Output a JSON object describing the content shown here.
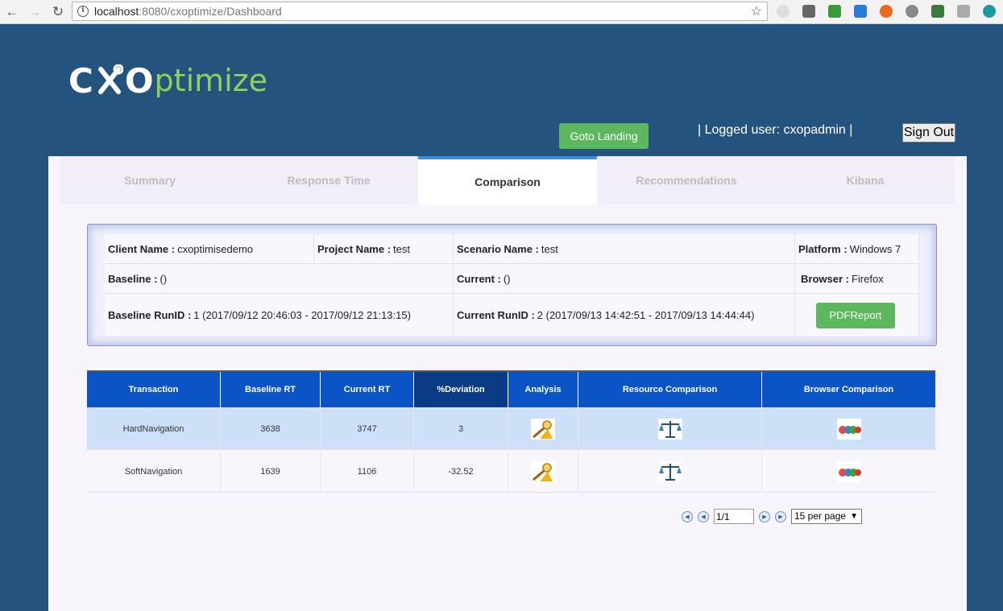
{
  "browser": {
    "url_host": "localhost",
    "url_rest": ":8080/cxoptimize/Dashboard"
  },
  "header": {
    "logo_cxo_left": "C",
    "logo_cxo_right": "O",
    "logo_rest": "ptimize",
    "goto_label": "Goto Landing",
    "logged_user": "| Logged user: cxopadmin |",
    "signout_label": "Sign Out"
  },
  "tabs": [
    {
      "label": "Summary"
    },
    {
      "label": "Response Time"
    },
    {
      "label": "Comparison"
    },
    {
      "label": "Recommendations"
    },
    {
      "label": "Kibana"
    }
  ],
  "info": {
    "client_label": "Client Name :",
    "client_value": "cxoptimisedemo",
    "project_label": "Project Name :",
    "project_value": "test",
    "scenario_label": "Scenario Name :",
    "scenario_value": "test",
    "platform_label": "Platform :",
    "platform_value": "Windows 7",
    "baseline_label": "Baseline :",
    "baseline_value": "()",
    "current_label": "Current :",
    "current_value": "()",
    "browser_label": "Browser :",
    "browser_value": "Firefox",
    "baseline_run_label": "Baseline RunID :",
    "baseline_run_value": "1 (2017/09/12 20:46:03 - 2017/09/12 21:13:15)",
    "current_run_label": "Current RunID :",
    "current_run_value": "2 (2017/09/13 14:42:51 - 2017/09/13 14:44:44)",
    "pdf_label": "PDFReport"
  },
  "table": {
    "headers": [
      "Transaction",
      "Baseline RT",
      "Current RT",
      "%Deviation",
      "Analysis",
      "Resource Comparison",
      "Browser Comparison"
    ],
    "rows": [
      {
        "transaction": "HardNavigation",
        "baseline": "3638",
        "current": "3747",
        "deviation": "3"
      },
      {
        "transaction": "SoftNavigation",
        "baseline": "1639",
        "current": "1106",
        "deviation": "-32.52"
      }
    ]
  },
  "pager": {
    "page_value": "1/1",
    "per_page": "15 per page"
  }
}
